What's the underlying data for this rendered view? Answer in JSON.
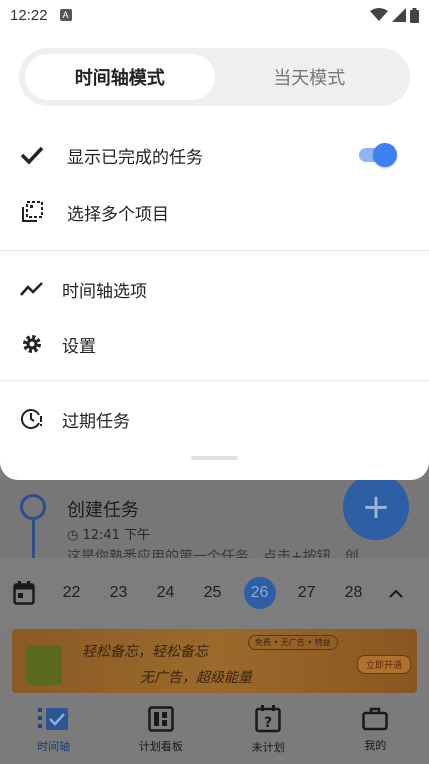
{
  "status_bar": {
    "time": "12:22",
    "notification_icon": "A"
  },
  "mode_switch": {
    "options": [
      "时间轴模式",
      "当天模式"
    ],
    "selected": "时间轴模式"
  },
  "menu": {
    "show_completed": {
      "label": "显示已完成的任务",
      "enabled": true
    },
    "select_multiple": {
      "label": "选择多个项目"
    },
    "timeline_options": {
      "label": "时间轴选项"
    },
    "settings": {
      "label": "设置"
    },
    "overdue_tasks": {
      "label": "过期任务"
    }
  },
  "background": {
    "task": {
      "title": "创建任务",
      "time": "12:41 下午",
      "description": "这是你熟悉应用的第一个任务，点击+按钮，创"
    },
    "fab_label": "+",
    "dates": [
      "22",
      "23",
      "24",
      "25",
      "26",
      "27",
      "28"
    ],
    "selected_date": "26",
    "ad": {
      "line1": "轻松备忘，轻松备忘",
      "line2": "无广告，超级能量",
      "tag": "免费 • 无广告 • 特益",
      "button": "立即开通"
    },
    "bottom_nav": [
      {
        "label": "时间轴",
        "icon": "timeline-check-icon",
        "active": true
      },
      {
        "label": "计划看板",
        "icon": "board-icon",
        "active": false
      },
      {
        "label": "未计划",
        "icon": "unplanned-calendar-icon",
        "active": false
      },
      {
        "label": "我的",
        "icon": "briefcase-icon",
        "active": false
      }
    ]
  },
  "colors": {
    "accent": "#3b82f0",
    "toggle_track": "#8fb5f4",
    "scrim": "#7c7c7c"
  }
}
